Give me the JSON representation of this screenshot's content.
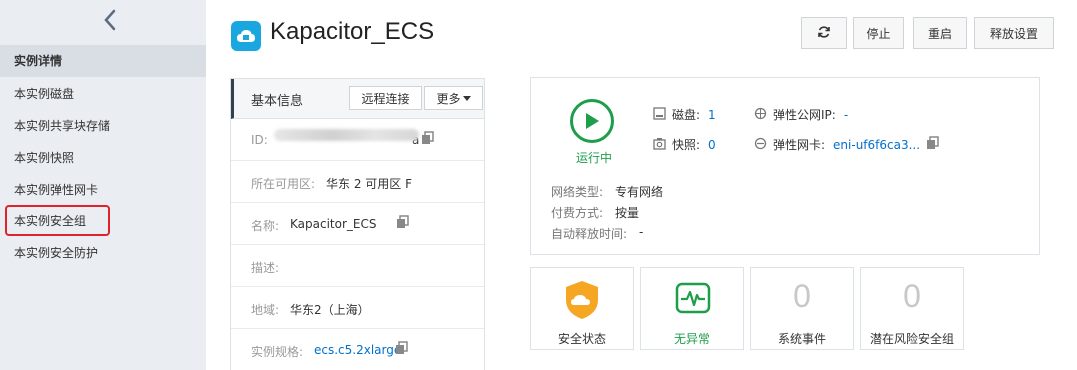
{
  "sidebar": {
    "items": [
      {
        "label": "实例详情"
      },
      {
        "label": "本实例磁盘"
      },
      {
        "label": "本实例共享块存储"
      },
      {
        "label": "本实例快照"
      },
      {
        "label": "本实例弹性网卡"
      },
      {
        "label": "本实例安全组"
      },
      {
        "label": "本实例安全防护"
      }
    ]
  },
  "header": {
    "title": "Kapacitor_ECS",
    "refresh_icon": "refresh-icon",
    "buttons": {
      "stop": "停止",
      "restart": "重启",
      "release": "释放设置"
    }
  },
  "basic_info": {
    "title": "基本信息",
    "remote_btn": "远程连接",
    "more_btn": "更多",
    "id_label": "ID:",
    "id_tail": "a",
    "zone_label": "所在可用区:",
    "zone_value": "华东 2 可用区 F",
    "name_label": "名称:",
    "name_value": "Kapacitor_ECS",
    "desc_label": "描述:",
    "region_label": "地域:",
    "region_value": "华东2（上海）",
    "spec_label": "实例规格:",
    "spec_value": "ecs.c5.2xlarge"
  },
  "status": {
    "running_label": "运行中",
    "disk_label": "磁盘:",
    "disk_value": "1",
    "snapshot_label": "快照:",
    "snapshot_value": "0",
    "eip_label": "弹性公网IP:",
    "eip_value": "-",
    "eni_label": "弹性网卡:",
    "eni_value": "eni-uf6f6ca3...",
    "network_type_label": "网络类型:",
    "network_type_value": "专有网络",
    "billing_label": "付费方式:",
    "billing_value": "按量",
    "auto_release_label": "自动释放时间:",
    "auto_release_value": "-"
  },
  "cards": {
    "security_status": "安全状态",
    "no_anomaly": "无异常",
    "system_events_count": "0",
    "system_events": "系统事件",
    "risk_groups_count": "0",
    "risk_groups": "潜在风险安全组"
  },
  "colors": {
    "accent": "#0070cc",
    "running": "#1e9e4a",
    "warning": "#f5a623",
    "highlight": "#e0222f"
  }
}
